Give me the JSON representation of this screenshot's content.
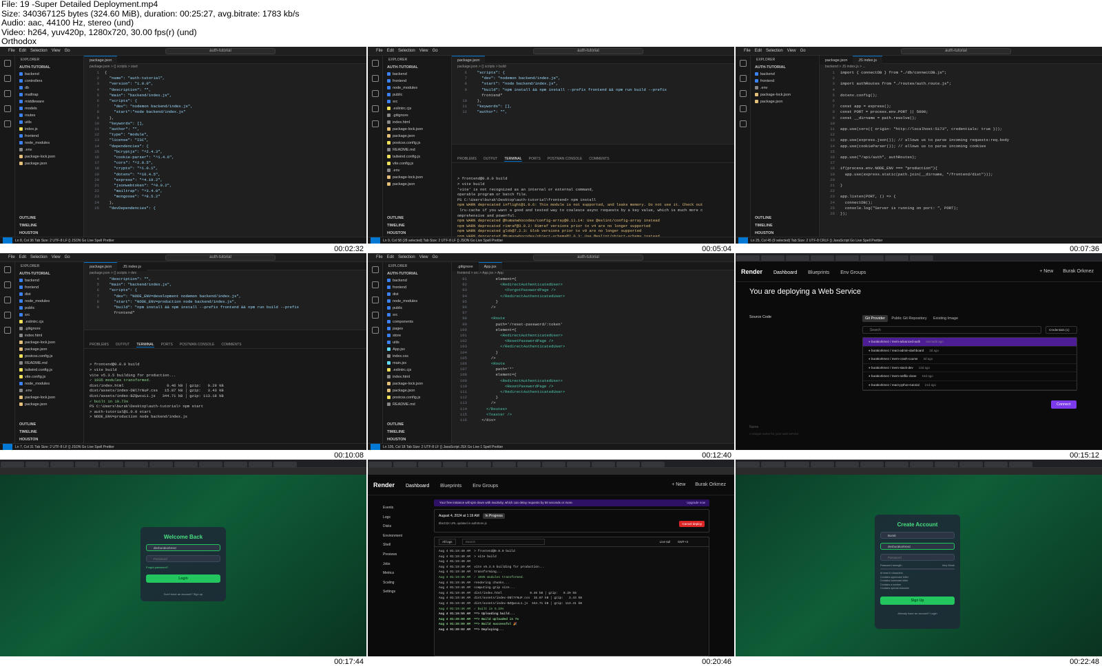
{
  "header": {
    "line1": "File: 19 -Super Detailed Deployment.mp4",
    "line2": "Size: 340367125 bytes (324.60 MiB), duration: 00:25:27, avg.bitrate: 1783 kb/s",
    "line3": "Audio: aac, 44100 Hz, stereo (und)",
    "line4": "Video: h264, yuv420p, 1280x720, 30.00 fps(r) (und)",
    "line5": "Orthodox"
  },
  "timestamps": [
    "00:02:32",
    "00:05:04",
    "00:07:36",
    "00:10:08",
    "00:12:40",
    "00:15:12",
    "00:17:44",
    "00:20:46",
    "00:22:48"
  ],
  "vscode": {
    "menu": [
      "File",
      "Edit",
      "Selection",
      "View",
      "Go"
    ],
    "project": "auth-tutorial",
    "explorer_title": "EXPLORER",
    "root": "AUTH-TUTORIAL",
    "outline": "OUTLINE",
    "timeline": "TIMELINE",
    "houston": "HOUSTON",
    "tab_pkg": "package.json",
    "tab_index": "JS index.js",
    "tab_app": "App.jsx",
    "tab_gitignore": ".gitignore",
    "status1": "Ln 8, Col 36   Tab Size: 2   UTF-8   LF   {} JSON   Go Live   Spell   Prettier",
    "status2": "Ln 9, Col 58 (28 selected)   Tab Size: 2   UTF-8   LF   {} JSON   Go Live   Spell   Prettier",
    "status3": "Ln 25, Col 45 (9 selected)   Tab Size: 2   UTF-8   CRLF   {} JavaScript   Go Live   Spell   Prettier",
    "status4": "Ln 7, Col 31   Tab Size: 2   UTF-8   LF   {} JSON   Go Live   Spell   Prettier",
    "status5": "Ln 105, Col 18   Tab Size: 2   UTF-8   LF   {} JavaScript JSX   Go Live   1 Spell   Prettier",
    "terminal_tabs": [
      "PROBLEMS",
      "OUTPUT",
      "TERMINAL",
      "PORTS",
      "POSTMAN CONSOLE",
      "COMMENTS"
    ],
    "tree1": [
      "backend",
      "controllers",
      "db",
      "mailtrap",
      "middleware",
      "models",
      "routes",
      "utils",
      "index.js",
      "frontend",
      "node_modules",
      ".env",
      "package-lock.json",
      "package.json"
    ],
    "tree2": [
      "backend",
      "frontend",
      "node_modules",
      "public",
      "src",
      ".eslintrc.cjs",
      ".gitignore",
      "index.html",
      "package-lock.json",
      "package.json",
      "postcss.config.js",
      "README.md",
      "tailwind.config.js",
      "vite.config.js",
      ".env",
      "package-lock.json",
      "package.json"
    ],
    "tree3": [
      "backend",
      "frontend",
      ".env",
      "package-lock.json",
      "package.json"
    ],
    "tree4": [
      "backend",
      "frontend",
      "dist",
      "node_modules",
      "public",
      "src",
      ".eslintrc.cjs",
      ".gitignore",
      "index.html",
      "package-lock.json",
      "package.json",
      "postcss.config.js",
      "README.md",
      "tailwind.config.js",
      "vite.config.js",
      "node_modules",
      ".env",
      "package-lock.json",
      "package.json"
    ],
    "tree5": [
      "backend",
      "frontend",
      "dist",
      "node_modules",
      "public",
      "src",
      "components",
      "pages",
      "store",
      "utils",
      "App.jsx",
      "index.css",
      "main.jsx",
      ".eslintrc.cjs",
      "index.html",
      "package-lock.json",
      "package.json",
      "postcss.config.js",
      "README.md"
    ],
    "breadcrumb1": "package.json > {} scripts > start",
    "breadcrumb2": "package.json > {} scripts > build",
    "breadcrumb3": "backend > JS index.js > ...",
    "breadcrumb4": "package.json > {} scripts > dev",
    "breadcrumb5": "frontend > src > App.jsx > App"
  },
  "code1": [
    [
      "1",
      "{"
    ],
    [
      "2",
      "  \"name\": \"auth-tutorial\","
    ],
    [
      "3",
      "  \"version\": \"1.0.0\","
    ],
    [
      "4",
      "  \"description\": \"\","
    ],
    [
      "5",
      "  \"main\": \"backend/index.js\","
    ],
    [
      "6",
      "  \"scripts\": {"
    ],
    [
      "7",
      "    \"dev\": \"nodemon backend/index.js\","
    ],
    [
      "8",
      "    \"start\":\"node backend/index.js\""
    ],
    [
      "9",
      "  },"
    ],
    [
      "10",
      "  \"keywords\": [],"
    ],
    [
      "11",
      "  \"author\": \"\","
    ],
    [
      "12",
      "  \"type\": \"module\","
    ],
    [
      "13",
      "  \"license\": \"ISC\","
    ],
    [
      "14",
      "  \"dependencies\": {"
    ],
    [
      "15",
      "    \"bcryptjs\": \"^2.4.3\","
    ],
    [
      "16",
      "    \"cookie-parser\": \"^1.4.6\","
    ],
    [
      "17",
      "    \"cors\": \"^2.8.5\","
    ],
    [
      "18",
      "    \"crypto\": \"^1.0.1\","
    ],
    [
      "19",
      "    \"dotenv\": \"^16.4.5\","
    ],
    [
      "20",
      "    \"express\": \"^4.19.2\","
    ],
    [
      "21",
      "    \"jsonwebtoken\": \"^9.0.2\","
    ],
    [
      "22",
      "    \"mailtrap\": \"^3.4.0\","
    ],
    [
      "23",
      "    \"mongoose\": \"^8.5.2\""
    ],
    [
      "24",
      "  },"
    ],
    [
      "25",
      "  \"devDependencies\": {"
    ]
  ],
  "code2": [
    [
      "6",
      "  \"scripts\": {"
    ],
    [
      "7",
      "    \"dev\": \"nodemon backend/index.js\","
    ],
    [
      "8",
      "    \"start\": \"node backend/index.js\","
    ],
    [
      "9",
      "    \"build\": \"npm install && npm install --prefix frontend && npm run build --prefix"
    ],
    [
      "",
      "    frontend\""
    ],
    [
      "10",
      "  },"
    ],
    [
      "11",
      "  \"keywords\": [],"
    ],
    [
      "12",
      "  \"author\": \"\","
    ]
  ],
  "term2": [
    "> frontend@0.0.0 build",
    "> vite build",
    "",
    "'vite' is not recognized as an internal or external command,",
    "operable program or batch file.",
    "PS C:\\Users\\burak\\Desktop\\auth-tutorial\\frontend> npm install",
    "npm WARN deprecated inflight@1.0.6: This module is not supported, and leaks memory. Do not use it. Check out",
    " lru-cache if you want a good and tested way to coalesce async requests by a key value, which is much more c",
    "omprehensive and powerful.",
    "npm WARN deprecated @humanwhocodes/config-array@0.11.14: Use @eslint/config-array instead",
    "npm WARN deprecated rimraf@3.0.2: Rimraf versions prior to v4 are no longer supported",
    "npm WARN deprecated glob@7.2.3: Glob versions prior to v9 are no longer supported",
    "npm WARN deprecated @humanwhocodes/object-schema@2.0.3: Use @eslint/object-schema instead",
    "[##########......] / reify:eslint: timing reifyNode:node_modules/framer-motion Completed in 11676ms"
  ],
  "code3": [
    [
      "1",
      "import { connectDB } from \"./db/connectDB.js\";"
    ],
    [
      "2",
      ""
    ],
    [
      "3",
      "import authRoutes from \"./routes/auth.route.js\";"
    ],
    [
      "4",
      ""
    ],
    [
      "5",
      "dotenv.config();"
    ],
    [
      "6",
      ""
    ],
    [
      "7",
      "const app = express();"
    ],
    [
      "8",
      "const PORT = process.env.PORT || 5000;"
    ],
    [
      "9",
      "const __dirname = path.resolve();"
    ],
    [
      "10",
      ""
    ],
    [
      "11",
      "app.use(cors({ origin: \"http://localhost:5173\", credentials: true }));"
    ],
    [
      "12",
      ""
    ],
    [
      "13",
      "app.use(express.json()); // allows us to parse incoming requests:req.body"
    ],
    [
      "14",
      "app.use(cookieParser()); // allows us to parse incoming cookies"
    ],
    [
      "15",
      ""
    ],
    [
      "16",
      "app.use(\"/api/auth\", authRoutes);"
    ],
    [
      "17",
      ""
    ],
    [
      "18",
      "if(process.env.NODE_ENV === \"production\"){"
    ],
    [
      "19",
      "  app.use(express.static(path.join(__dirname, \"/frontend/dist\")));"
    ],
    [
      "20",
      ""
    ],
    [
      "21",
      "}"
    ],
    [
      "22",
      ""
    ],
    [
      "23",
      "app.listen(PORT, () => {"
    ],
    [
      "24",
      "  connectDB();"
    ],
    [
      "25",
      "  console.log(\"Server is running on port: \", PORT);"
    ],
    [
      "26",
      "});"
    ]
  ],
  "code4": [
    [
      "4",
      "  \"description\": \"\","
    ],
    [
      "5",
      "  \"main\": \"backend/index.js\","
    ],
    [
      "6",
      "  \"scripts\": {"
    ],
    [
      "7",
      "    \"dev\": \"NODE_ENV=development nodemon backend/index.js\","
    ],
    [
      "8",
      "    \"start\": \"NODE_ENV=production node backend/index.js\","
    ],
    [
      "9",
      "    \"build\": \"npm install && npm install --prefix frontend && npm run build --prefix"
    ],
    [
      "",
      "    frontend\""
    ]
  ],
  "term4": [
    "> frontend@0.0.0 build",
    "> vite build",
    "",
    "vite v5.3.5 building for production...",
    "✓ 1935 modules transformed.",
    "dist/index.html                   0.46 kB │ gzip:   0.29 kB",
    "dist/assets/index-DBl7rNuP.css   15.87 kB │ gzip:   3.43 kB",
    "dist/assets/index-BZQwcuL1.js   344.71 kB │ gzip: 113.18 kB",
    "✓ built in 10.73s",
    "PS C:\\Users\\burak\\Desktop\\auth-tutorial> npm start",
    "",
    "> auth-tutorial@1.0.0 start",
    "> NODE_ENV=production node backend/index.js"
  ],
  "code5": [
    [
      "91",
      "          element={"
    ],
    [
      "92",
      "            <RedirectAuthenticatedUser>"
    ],
    [
      "93",
      "              <ForgotPasswordPage />"
    ],
    [
      "94",
      "            </RedirectAuthenticatedUser>"
    ],
    [
      "95",
      "          }"
    ],
    [
      "96",
      "        />"
    ],
    [
      "97",
      ""
    ],
    [
      "98",
      "        <Route"
    ],
    [
      "99",
      "          path='/reset-password/:token'"
    ],
    [
      "100",
      "          element={"
    ],
    [
      "101",
      "            <RedirectAuthenticatedUser>"
    ],
    [
      "102",
      "              <ResetPasswordPage />"
    ],
    [
      "103",
      "            </RedirectAuthenticatedUser>"
    ],
    [
      "104",
      "          }"
    ],
    [
      "105",
      "        />"
    ],
    [
      "106",
      "        <Route"
    ],
    [
      "107",
      "          path='*'"
    ],
    [
      "108",
      "          element={"
    ],
    [
      "109",
      "            <RedirectAuthenticatedUser>"
    ],
    [
      "110",
      "              <ResetPasswordPage />"
    ],
    [
      "111",
      "            </RedirectAuthenticatedUser>"
    ],
    [
      "112",
      "          }"
    ],
    [
      "113",
      "        />"
    ],
    [
      "114",
      "      </Routes>"
    ],
    [
      "115",
      "      <Toaster />"
    ],
    [
      "116",
      "    </div>"
    ]
  ],
  "render": {
    "logo": "Render",
    "nav": [
      "Dashboard",
      "Blueprints",
      "Env Groups"
    ],
    "new": "+ New",
    "user": "Burak Orkmez",
    "deploy_title": "You are deploying a Web Service",
    "source_code": "Source Code",
    "providers": [
      "Git Provider",
      "Public Git Repository",
      "Existing Image"
    ],
    "search": "Search",
    "credentials": "Credentials (1)",
    "repos": [
      "burakorkmez / mern-advanced-auth",
      "burakorkmez / react-admin-dashboard",
      "burakorkmez / mern-crash-course",
      "burakorkmez / mern-stack-dev",
      "burakorkmez / mern-netflix-clone",
      "burakorkmez / react-python-tutorial"
    ],
    "repo_ages": [
      "seconds ago",
      "3d ago",
      "3d ago",
      "13d ago",
      "15d ago",
      "21d ago"
    ],
    "connect": "Connect",
    "name_label": "Name",
    "name_hint": "A unique name for your web service.",
    "side": [
      "Events",
      "Logs",
      "Disks",
      "Environment",
      "Shell",
      "Previews",
      "Jobs",
      "Metrics",
      "Scaling",
      "Settings"
    ],
    "banner": "Your free instance will spin down with inactivity, which can delay requests by 50 seconds or more.",
    "upgrade": "Upgrade now",
    "deploy_date": "August 4, 2024 at 1:19 AM",
    "in_progress": "In Progress",
    "commit": "8be232c   URL updated in authStore.js",
    "cancel_deploy": "Cancel deploy",
    "all_logs": "All logs",
    "log_search": "Search",
    "live_tail": "Live tail",
    "tz": "GMT+3",
    "logs": [
      "Aug 4 01:19:40 AM  > frontend@0.0.0 build",
      "Aug 4 01:19:40 AM  > vite build",
      "Aug 4 01:19:40 AM",
      "Aug 4 01:19:40 AM  vite v5.3.5 building for production...",
      "Aug 4 01:19:40 AM  transforming...",
      "Aug 4 01:19:46 AM  ✓ 1935 modules transformed.",
      "Aug 4 01:19:46 AM  rendering chunks...",
      "Aug 4 01:19:46 AM  computing gzip size...",
      "Aug 4 01:19:46 AM  dist/index.html               0.46 kB │ gzip:   0.29 kB",
      "Aug 4 01:19:46 AM  dist/assets/index-DBl7rNuP.css  15.87 kB │ gzip:   3.43 kB",
      "Aug 4 01:19:46 AM  dist/assets/index-BZQwcuL1.js  344.71 kB │ gzip: 113.41 kB",
      "Aug 4 01:19:46 AM  ✓ built in 5.19s",
      "Aug 4 01:19:55 AM  ==> Uploading build...",
      "Aug 4 01:20:00 AM  ==> Build uploaded in 7s",
      "Aug 4 01:20:00 AM  ==> Build successful 🎉",
      "Aug 4 01:20:02 AM  ==> Deploying..."
    ]
  },
  "login": {
    "title": "Welcome Back",
    "email": "devburakorkmez",
    "password": "Password",
    "forgot": "Forgot password?",
    "button": "Login",
    "footer": "Don't have an account? Sign up"
  },
  "signup": {
    "title": "Create Account",
    "name": "Burak",
    "email": "devburakorkmez",
    "password": "Password",
    "strength": "Password strength",
    "strength_val": "Very Weak",
    "rules": [
      "At least 6 characters",
      "Contains uppercase letter",
      "Contains lowercase letter",
      "Contains a number",
      "Contains special character"
    ],
    "button": "Sign Up",
    "footer": "Already have an account? Login"
  },
  "colors": {
    "vscode_bg": "#1f1f1f",
    "accent_blue": "#0078d4",
    "render_purple": "#7c3aed",
    "green": "#22c55e"
  }
}
